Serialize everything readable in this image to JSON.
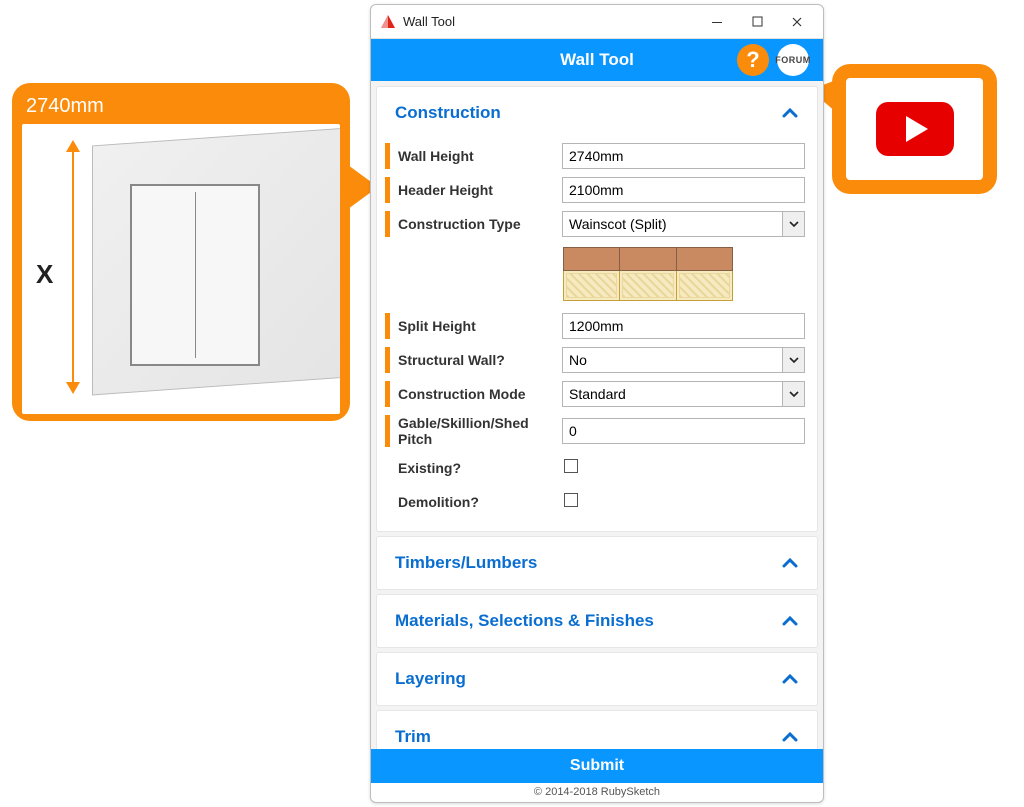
{
  "callout_left": {
    "value": "2740mm",
    "dim_symbol": "X"
  },
  "callout_right": {
    "icon": "youtube"
  },
  "window": {
    "title": "Wall Tool",
    "header": "Wall Tool",
    "help_label": "?",
    "forum_label": "FORUM",
    "submit": "Submit",
    "footer": "© 2014-2018 RubySketch"
  },
  "sections": {
    "construction": {
      "title": "Construction",
      "fields": {
        "wall_height": {
          "label": "Wall Height",
          "value": "2740mm"
        },
        "header_height": {
          "label": "Header Height",
          "value": "2100mm"
        },
        "construction_type": {
          "label": "Construction Type",
          "value": "Wainscot (Split)"
        },
        "split_height": {
          "label": "Split Height",
          "value": "1200mm"
        },
        "structural": {
          "label": "Structural Wall?",
          "value": "No"
        },
        "mode": {
          "label": "Construction Mode",
          "value": "Standard"
        },
        "pitch": {
          "label": "Gable/Skillion/Shed Pitch",
          "value": "0"
        },
        "existing": {
          "label": "Existing?"
        },
        "demolition": {
          "label": "Demolition?"
        }
      }
    },
    "timbers": {
      "title": "Timbers/Lumbers"
    },
    "materials": {
      "title": "Materials, Selections & Finishes"
    },
    "layering": {
      "title": "Layering"
    },
    "trim": {
      "title": "Trim"
    }
  }
}
